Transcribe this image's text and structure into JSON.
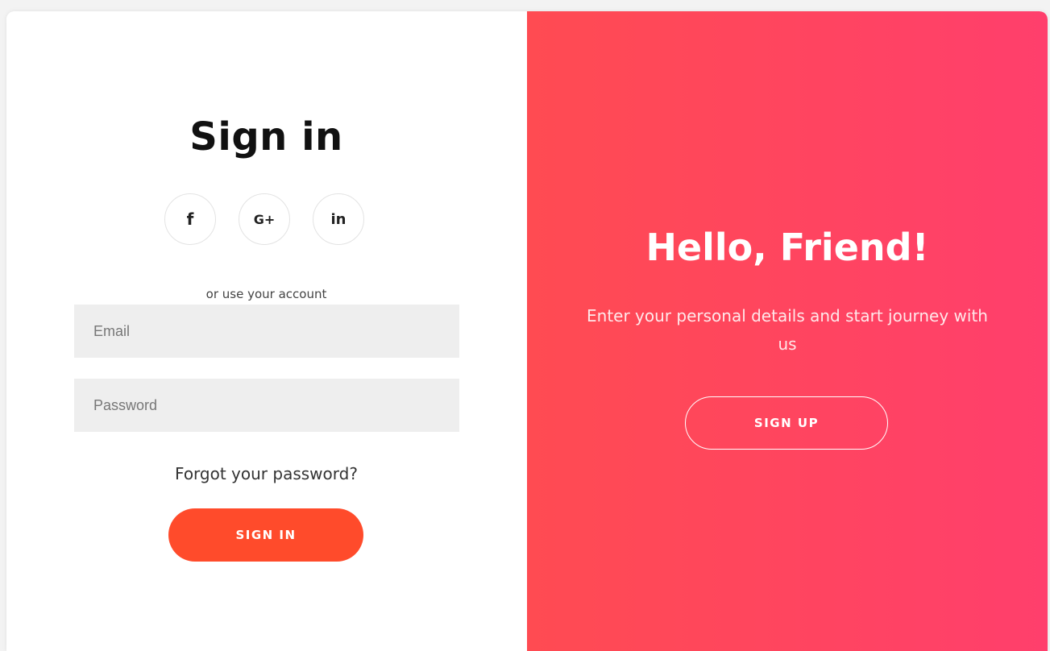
{
  "sign_in": {
    "title": "Sign in",
    "socials": [
      {
        "icon": "facebook-icon",
        "glyph": "f"
      },
      {
        "icon": "google-plus-icon",
        "glyph": "G+"
      },
      {
        "icon": "linkedin-icon",
        "glyph": "in"
      }
    ],
    "or_text": "or use your account",
    "email_placeholder": "Email",
    "password_placeholder": "Password",
    "forgot": "Forgot your password?",
    "button": "SIGN IN"
  },
  "overlay": {
    "title": "Hello, Friend!",
    "text": "Enter your personal details and start journey with us",
    "button": "SIGN UP"
  },
  "colors": {
    "accent": "#ff4b2b",
    "overlay_start": "#ff4b52",
    "overlay_end": "#ff3f6c",
    "input_bg": "#eeeeee"
  }
}
